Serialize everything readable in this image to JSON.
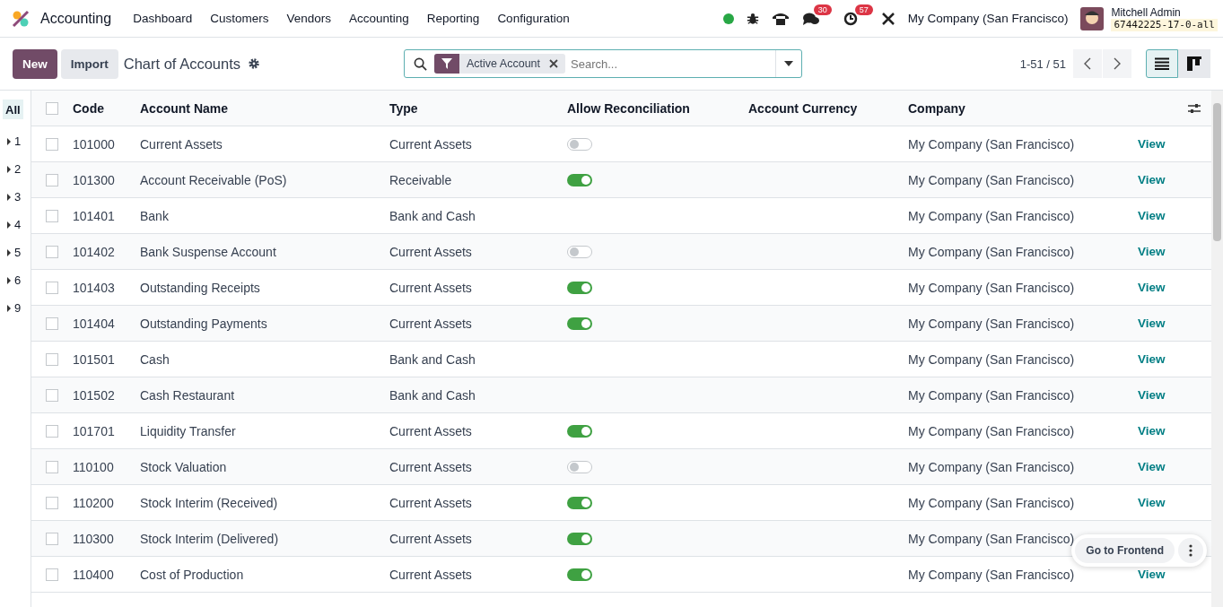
{
  "app": {
    "name": "Accounting"
  },
  "menu": [
    {
      "label": "Dashboard"
    },
    {
      "label": "Customers"
    },
    {
      "label": "Vendors"
    },
    {
      "label": "Accounting"
    },
    {
      "label": "Reporting"
    },
    {
      "label": "Configuration"
    }
  ],
  "systray": {
    "messages_count": "30",
    "activities_count": "57",
    "company": "My Company (San Francisco)",
    "user": "Mitchell Admin",
    "database": "67442225-17-0-all"
  },
  "control_panel": {
    "new_button": "New",
    "import_button": "Import",
    "title": "Chart of Accounts",
    "facet": "Active Account",
    "search": {
      "placeholder": "Search..."
    },
    "pager": "1-51 / 51",
    "views": [
      {
        "kind": "list",
        "selected": true
      },
      {
        "kind": "kanban",
        "selected": false
      }
    ]
  },
  "groups": [
    {
      "label": "All",
      "selected": true
    },
    {
      "label": "1",
      "selected": false
    },
    {
      "label": "2",
      "selected": false
    },
    {
      "label": "3",
      "selected": false
    },
    {
      "label": "4",
      "selected": false
    },
    {
      "label": "5",
      "selected": false
    },
    {
      "label": "6",
      "selected": false
    },
    {
      "label": "9",
      "selected": false
    }
  ],
  "table": {
    "all_selected": false,
    "columns": [
      "Code",
      "Account Name",
      "Type",
      "Allow Reconciliation",
      "Account Currency",
      "Company"
    ],
    "rows": [
      {
        "code": "101000",
        "name": "Current Assets",
        "type": "Current Assets",
        "reconcile": false,
        "company": "My Company (San Francisco)",
        "action": "View",
        "checked": false
      },
      {
        "code": "101300",
        "name": "Account Receivable (PoS)",
        "type": "Receivable",
        "reconcile": true,
        "company": "My Company (San Francisco)",
        "action": "View",
        "checked": false
      },
      {
        "code": "101401",
        "name": "Bank",
        "type": "Bank and Cash",
        "company": "My Company (San Francisco)",
        "action": "View",
        "checked": false
      },
      {
        "code": "101402",
        "name": "Bank Suspense Account",
        "type": "Current Assets",
        "reconcile": false,
        "company": "My Company (San Francisco)",
        "action": "View",
        "checked": false
      },
      {
        "code": "101403",
        "name": "Outstanding Receipts",
        "type": "Current Assets",
        "reconcile": true,
        "company": "My Company (San Francisco)",
        "action": "View",
        "checked": false
      },
      {
        "code": "101404",
        "name": "Outstanding Payments",
        "type": "Current Assets",
        "reconcile": true,
        "company": "My Company (San Francisco)",
        "action": "View",
        "checked": false
      },
      {
        "code": "101501",
        "name": "Cash",
        "type": "Bank and Cash",
        "company": "My Company (San Francisco)",
        "action": "View",
        "checked": false
      },
      {
        "code": "101502",
        "name": "Cash Restaurant",
        "type": "Bank and Cash",
        "company": "My Company (San Francisco)",
        "action": "View",
        "checked": false
      },
      {
        "code": "101701",
        "name": "Liquidity Transfer",
        "type": "Current Assets",
        "reconcile": true,
        "company": "My Company (San Francisco)",
        "action": "View",
        "checked": false
      },
      {
        "code": "110100",
        "name": "Stock Valuation",
        "type": "Current Assets",
        "reconcile": false,
        "company": "My Company (San Francisco)",
        "action": "View",
        "checked": false
      },
      {
        "code": "110200",
        "name": "Stock Interim (Received)",
        "type": "Current Assets",
        "reconcile": true,
        "company": "My Company (San Francisco)",
        "action": "View",
        "checked": false
      },
      {
        "code": "110300",
        "name": "Stock Interim (Delivered)",
        "type": "Current Assets",
        "reconcile": true,
        "company": "My Company (San Francisco)",
        "checked": false
      },
      {
        "code": "110400",
        "name": "Cost of Production",
        "type": "Current Assets",
        "reconcile": true,
        "company": "My Company (San Francisco)",
        "action": "View",
        "checked": false
      }
    ]
  },
  "floating": {
    "label": "Go to Frontend"
  }
}
